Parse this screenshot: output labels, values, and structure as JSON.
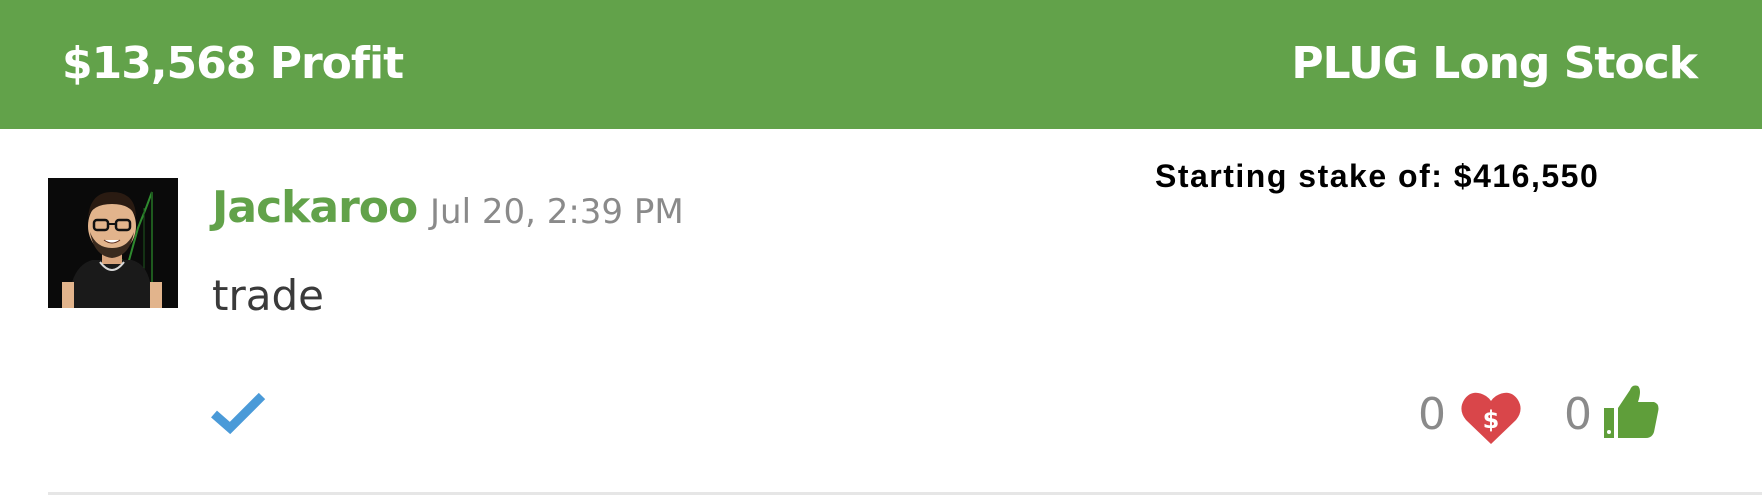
{
  "header": {
    "profit_label": "$13,568 Profit",
    "trade_label": "PLUG Long Stock",
    "bg_color": "#62a24a"
  },
  "post": {
    "author": "Jackaroo",
    "timestamp": "Jul 20, 2:39 PM",
    "message": "trade",
    "starting_stake": "Starting stake of: $416,550",
    "avatar_icon": "avatar-icon"
  },
  "actions": {
    "verified_icon": "check-icon",
    "profit_count": "0",
    "profit_icon": "dollar-heart-icon",
    "like_count": "0",
    "like_icon": "thumbs-up-icon"
  },
  "colors": {
    "brand_green": "#62a24a",
    "check_blue": "#4a9ad8",
    "heart_red": "#d9464a"
  }
}
